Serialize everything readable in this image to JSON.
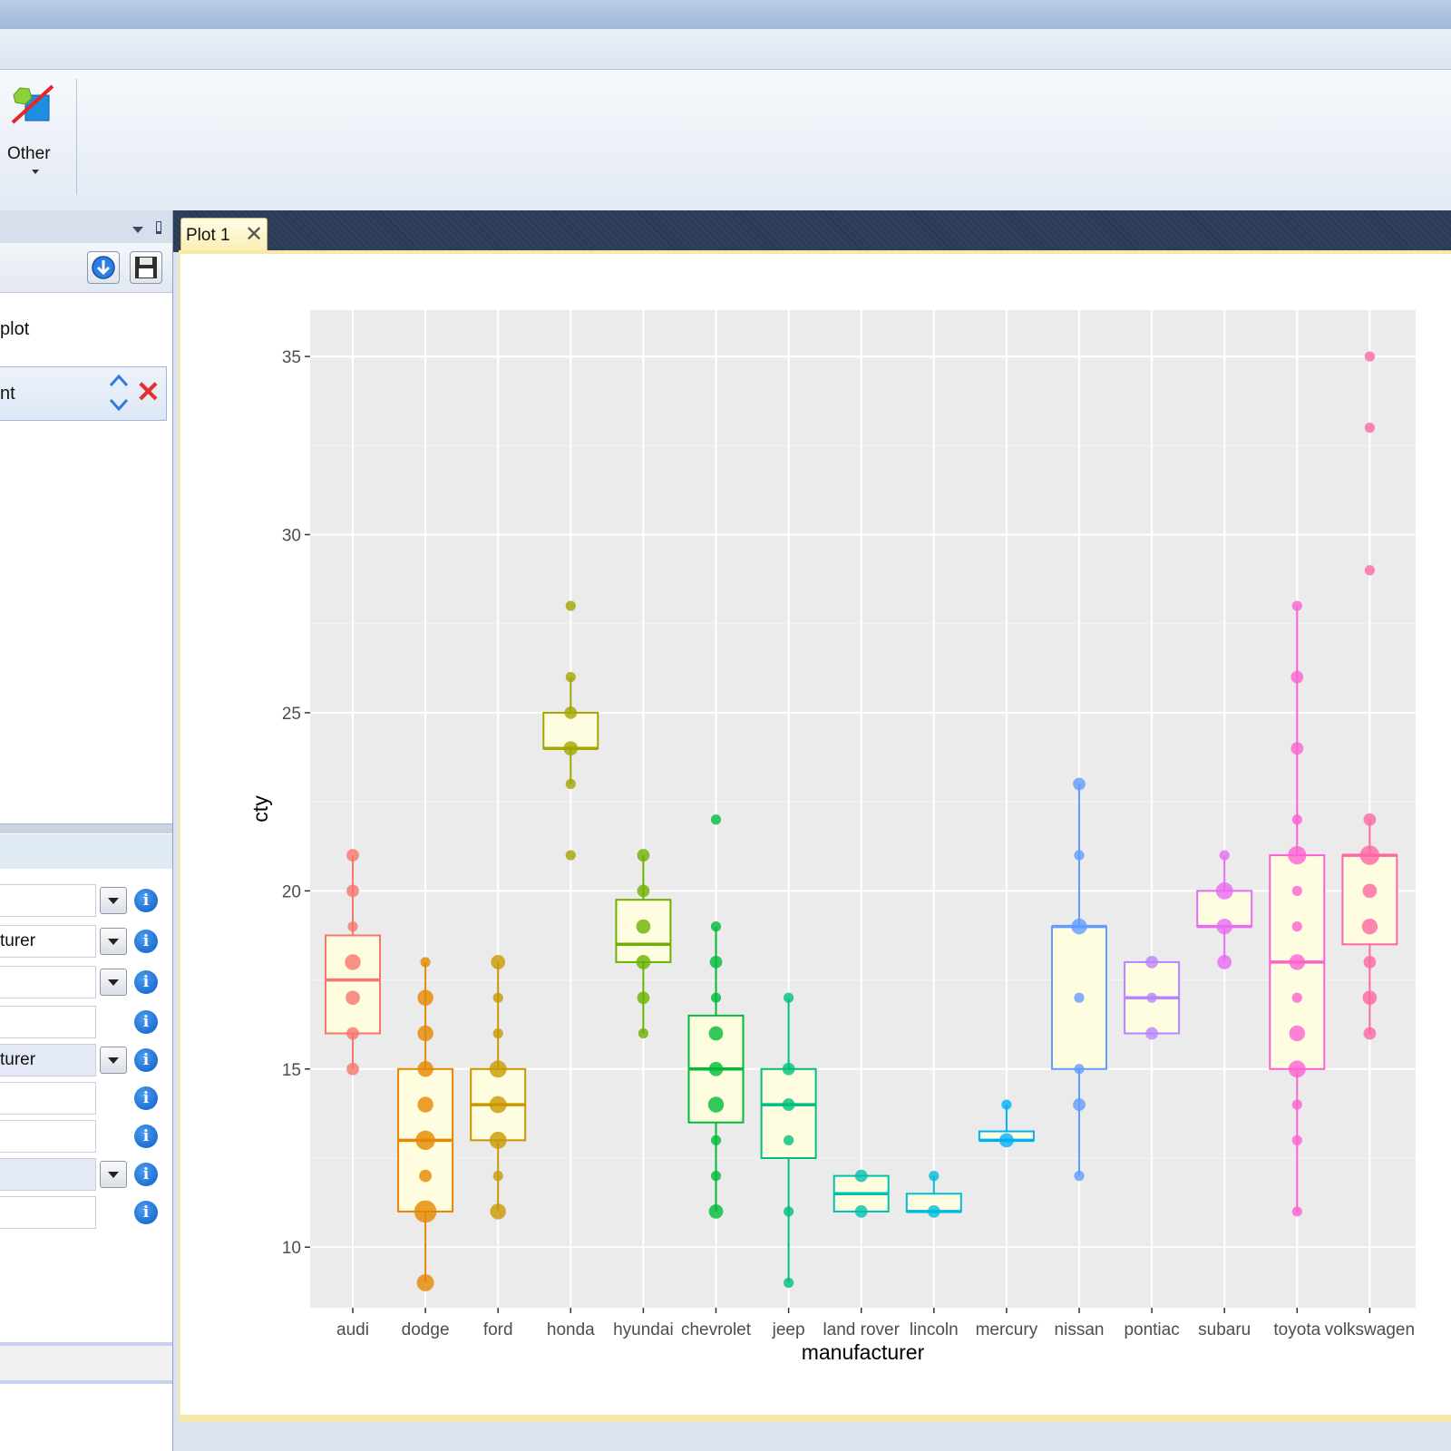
{
  "ribbon": {
    "other_label": "Other"
  },
  "left_panel": {
    "item1_label": "plot",
    "item2_label": "nt",
    "properties": [
      {
        "value": "",
        "dropdown": true,
        "highlight": false
      },
      {
        "value": "turer",
        "dropdown": true,
        "highlight": false
      },
      {
        "value": "",
        "dropdown": true,
        "highlight": false
      },
      {
        "value": "",
        "dropdown": false,
        "highlight": false
      },
      {
        "value": "turer",
        "dropdown": true,
        "highlight": true
      },
      {
        "value": "",
        "dropdown": false,
        "highlight": false
      },
      {
        "value": "",
        "dropdown": false,
        "highlight": false
      },
      {
        "value": "",
        "dropdown": true,
        "highlight": true
      },
      {
        "value": "",
        "dropdown": false,
        "highlight": false
      }
    ],
    "info_glyph": "i"
  },
  "tabs": [
    {
      "label": "Plot 1",
      "close": "✕"
    }
  ],
  "chart_data": {
    "type": "boxplot",
    "xlabel": "manufacturer",
    "ylabel": "cty",
    "ylim": [
      8.3,
      36.3
    ],
    "yticks": [
      10,
      15,
      20,
      25,
      30,
      35
    ],
    "grid": true,
    "box_fill": "#fffde0",
    "categories": [
      "audi",
      "dodge",
      "ford",
      "honda",
      "hyundai",
      "chevrolet",
      "jeep",
      "land rover",
      "lincoln",
      "mercury",
      "nissan",
      "pontiac",
      "subaru",
      "toyota",
      "volkswagen"
    ],
    "colors": [
      "#f8766d",
      "#e58700",
      "#c99800",
      "#a3a500",
      "#6bb100",
      "#00ba38",
      "#00bf7d",
      "#00c0af",
      "#00bcd8",
      "#00b0f6",
      "#619cff",
      "#b983ff",
      "#e76bf3",
      "#fd61d1",
      "#ff67a4"
    ],
    "boxes": [
      {
        "q1": 16,
        "median": 17.5,
        "q3": 18.75,
        "whisker_low": 15,
        "whisker_high": 21
      },
      {
        "q1": 11,
        "median": 13,
        "q3": 15,
        "whisker_low": 9,
        "whisker_high": 18
      },
      {
        "q1": 13,
        "median": 14,
        "q3": 15,
        "whisker_low": 11,
        "whisker_high": 18
      },
      {
        "q1": 24,
        "median": 24,
        "q3": 25,
        "whisker_low": 23,
        "whisker_high": 26
      },
      {
        "q1": 18,
        "median": 18.5,
        "q3": 19.75,
        "whisker_low": 16,
        "whisker_high": 21
      },
      {
        "q1": 13.5,
        "median": 15,
        "q3": 16.5,
        "whisker_low": 11,
        "whisker_high": 19
      },
      {
        "q1": 12.5,
        "median": 14,
        "q3": 15,
        "whisker_low": 9,
        "whisker_high": 17
      },
      {
        "q1": 11,
        "median": 11.5,
        "q3": 12,
        "whisker_low": 11,
        "whisker_high": 12
      },
      {
        "q1": 11,
        "median": 11,
        "q3": 11.5,
        "whisker_low": 11,
        "whisker_high": 12
      },
      {
        "q1": 13,
        "median": 13,
        "q3": 13.25,
        "whisker_low": 13,
        "whisker_high": 14
      },
      {
        "q1": 15,
        "median": 19,
        "q3": 19,
        "whisker_low": 12,
        "whisker_high": 23
      },
      {
        "q1": 16,
        "median": 17,
        "q3": 18,
        "whisker_low": 16,
        "whisker_high": 18
      },
      {
        "q1": 19,
        "median": 19,
        "q3": 20,
        "whisker_low": 18,
        "whisker_high": 21
      },
      {
        "q1": 15,
        "median": 18,
        "q3": 21,
        "whisker_low": 11,
        "whisker_high": 28
      },
      {
        "q1": 18.5,
        "median": 21,
        "q3": 21,
        "whisker_low": 16,
        "whisker_high": 22
      }
    ],
    "points": [
      [
        {
          "y": 15,
          "n": 2
        },
        {
          "y": 16,
          "n": 2
        },
        {
          "y": 17,
          "n": 3
        },
        {
          "y": 18,
          "n": 4
        },
        {
          "y": 19,
          "n": 1
        },
        {
          "y": 20,
          "n": 2
        },
        {
          "y": 21,
          "n": 2
        }
      ],
      [
        {
          "y": 9,
          "n": 5
        },
        {
          "y": 11,
          "n": 10
        },
        {
          "y": 12,
          "n": 2
        },
        {
          "y": 13,
          "n": 7
        },
        {
          "y": 14,
          "n": 4
        },
        {
          "y": 15,
          "n": 4
        },
        {
          "y": 16,
          "n": 4
        },
        {
          "y": 17,
          "n": 4
        },
        {
          "y": 18,
          "n": 1
        }
      ],
      [
        {
          "y": 11,
          "n": 4
        },
        {
          "y": 12,
          "n": 1
        },
        {
          "y": 13,
          "n": 5
        },
        {
          "y": 14,
          "n": 5
        },
        {
          "y": 15,
          "n": 5
        },
        {
          "y": 16,
          "n": 1
        },
        {
          "y": 17,
          "n": 1
        },
        {
          "y": 18,
          "n": 3
        }
      ],
      [
        {
          "y": 21,
          "n": 1
        },
        {
          "y": 23,
          "n": 1
        },
        {
          "y": 24,
          "n": 3
        },
        {
          "y": 25,
          "n": 2
        },
        {
          "y": 26,
          "n": 1
        },
        {
          "y": 28,
          "n": 1
        }
      ],
      [
        {
          "y": 16,
          "n": 1
        },
        {
          "y": 17,
          "n": 2
        },
        {
          "y": 18,
          "n": 3
        },
        {
          "y": 19,
          "n": 3
        },
        {
          "y": 20,
          "n": 2
        },
        {
          "y": 21,
          "n": 2
        }
      ],
      [
        {
          "y": 11,
          "n": 3
        },
        {
          "y": 12,
          "n": 1
        },
        {
          "y": 13,
          "n": 1
        },
        {
          "y": 14,
          "n": 4
        },
        {
          "y": 15,
          "n": 3
        },
        {
          "y": 16,
          "n": 3
        },
        {
          "y": 17,
          "n": 1
        },
        {
          "y": 18,
          "n": 2
        },
        {
          "y": 19,
          "n": 1
        },
        {
          "y": 22,
          "n": 1
        }
      ],
      [
        {
          "y": 9,
          "n": 1
        },
        {
          "y": 11,
          "n": 1
        },
        {
          "y": 13,
          "n": 1
        },
        {
          "y": 14,
          "n": 2
        },
        {
          "y": 15,
          "n": 2
        },
        {
          "y": 17,
          "n": 1
        }
      ],
      [
        {
          "y": 11,
          "n": 2
        },
        {
          "y": 12,
          "n": 2
        }
      ],
      [
        {
          "y": 11,
          "n": 2
        },
        {
          "y": 12,
          "n": 1
        }
      ],
      [
        {
          "y": 13,
          "n": 3
        },
        {
          "y": 14,
          "n": 1
        }
      ],
      [
        {
          "y": 12,
          "n": 1
        },
        {
          "y": 14,
          "n": 2
        },
        {
          "y": 15,
          "n": 1
        },
        {
          "y": 17,
          "n": 1
        },
        {
          "y": 19,
          "n": 4
        },
        {
          "y": 21,
          "n": 1
        },
        {
          "y": 23,
          "n": 2
        }
      ],
      [
        {
          "y": 16,
          "n": 2
        },
        {
          "y": 17,
          "n": 1
        },
        {
          "y": 18,
          "n": 2
        }
      ],
      [
        {
          "y": 18,
          "n": 3
        },
        {
          "y": 19,
          "n": 4
        },
        {
          "y": 20,
          "n": 5
        },
        {
          "y": 21,
          "n": 1
        }
      ],
      [
        {
          "y": 11,
          "n": 1
        },
        {
          "y": 13,
          "n": 1
        },
        {
          "y": 14,
          "n": 1
        },
        {
          "y": 15,
          "n": 5
        },
        {
          "y": 16,
          "n": 4
        },
        {
          "y": 17,
          "n": 1
        },
        {
          "y": 18,
          "n": 4
        },
        {
          "y": 19,
          "n": 1
        },
        {
          "y": 20,
          "n": 1
        },
        {
          "y": 21,
          "n": 6
        },
        {
          "y": 22,
          "n": 1
        },
        {
          "y": 24,
          "n": 2
        },
        {
          "y": 26,
          "n": 2
        },
        {
          "y": 28,
          "n": 1
        }
      ],
      [
        {
          "y": 16,
          "n": 2
        },
        {
          "y": 17,
          "n": 3
        },
        {
          "y": 18,
          "n": 2
        },
        {
          "y": 19,
          "n": 4
        },
        {
          "y": 20,
          "n": 3
        },
        {
          "y": 21,
          "n": 7
        },
        {
          "y": 22,
          "n": 2
        },
        {
          "y": 29,
          "n": 1
        },
        {
          "y": 33,
          "n": 1
        },
        {
          "y": 35,
          "n": 1
        }
      ]
    ]
  }
}
